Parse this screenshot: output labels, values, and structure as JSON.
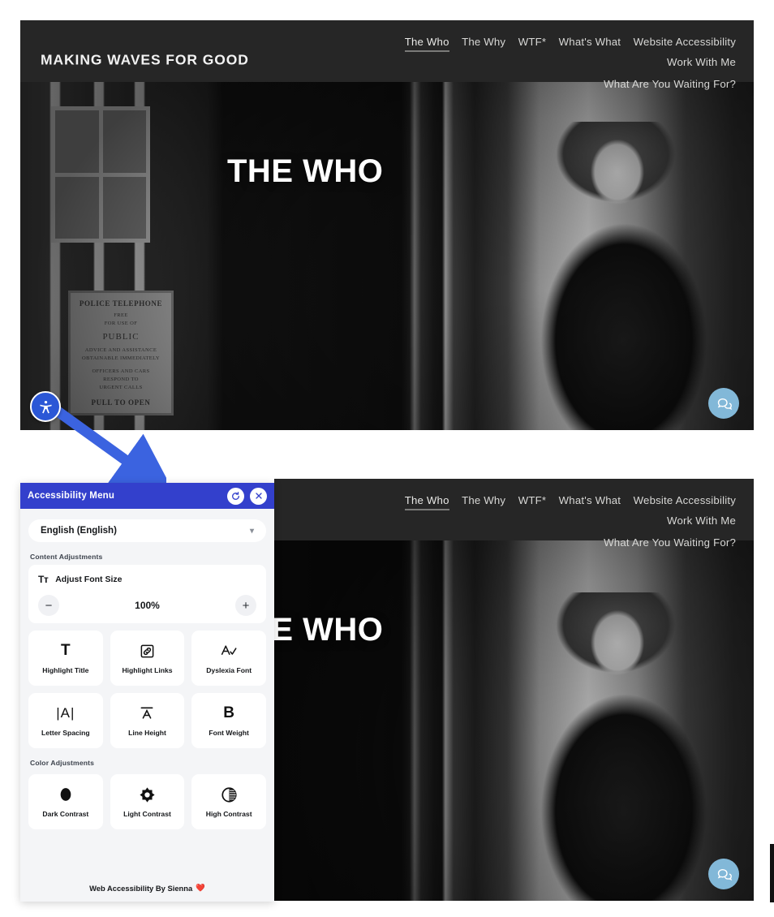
{
  "site": {
    "brand": "MAKING WAVES FOR GOOD",
    "nav": [
      {
        "label": "The Who",
        "active": true
      },
      {
        "label": "The Why",
        "active": false
      },
      {
        "label": "WTF*",
        "active": false
      },
      {
        "label": "What's What",
        "active": false
      },
      {
        "label": "Website Accessibility",
        "active": false
      },
      {
        "label": "Work With Me",
        "active": false
      },
      {
        "label": "What Are You Waiting For?",
        "active": false
      }
    ],
    "hero_title": "THE WHO",
    "police_sign": {
      "line1": "POLICE TELEPHONE",
      "line2": "FREE",
      "line3": "FOR USE OF",
      "line4": "PUBLIC",
      "line5": "ADVICE AND ASSISTANCE",
      "line6": "OBTAINABLE IMMEDIATELY",
      "line7": "OFFICERS AND CARS",
      "line8": "RESPOND TO",
      "line9": "URGENT     CALLS",
      "line10": "PULL TO OPEN"
    },
    "accessibility_fab": "accessibility-icon",
    "chat_fab": "chat-bubble-icon"
  },
  "panel": {
    "title": "Accessibility Menu",
    "reset_icon": "reset-icon",
    "close_icon": "close-icon",
    "language": "English (English)",
    "language_chevron": "chevron-down-icon",
    "content_section": "Content Adjustments",
    "font_size": {
      "icon": "Tт",
      "label": "Adjust Font Size",
      "decrease": "−",
      "value": "100%",
      "increase": "+"
    },
    "content_tiles": [
      {
        "glyph": "T",
        "label": "Highlight Title",
        "icon": "highlight-title-icon"
      },
      {
        "glyph": "link",
        "label": "Highlight Links",
        "icon": "highlight-links-icon"
      },
      {
        "glyph": "A-check",
        "label": "Dyslexia Font",
        "icon": "dyslexia-font-icon"
      },
      {
        "glyph": "|A|",
        "label": "Letter Spacing",
        "icon": "letter-spacing-icon"
      },
      {
        "glyph": "A-bar",
        "label": "Line Height",
        "icon": "line-height-icon"
      },
      {
        "glyph": "B",
        "label": "Font Weight",
        "icon": "font-weight-icon"
      }
    ],
    "color_section": "Color Adjustments",
    "color_tiles": [
      {
        "glyph": "circle-filled",
        "label": "Dark Contrast",
        "icon": "dark-contrast-icon"
      },
      {
        "glyph": "sun",
        "label": "Light Contrast",
        "icon": "light-contrast-icon"
      },
      {
        "glyph": "half-circle",
        "label": "High Contrast",
        "icon": "high-contrast-icon"
      }
    ],
    "footer_text": "Web Accessibility By Sienna",
    "footer_heart": "❤️",
    "colors": {
      "header_blue": "#3340cc",
      "panel_bg": "#f4f5f7",
      "tile_bg": "#ffffff",
      "fab_blue": "#2b57d6",
      "chat_blue": "#82b8d8",
      "arrow_blue": "#3b63e0"
    }
  }
}
